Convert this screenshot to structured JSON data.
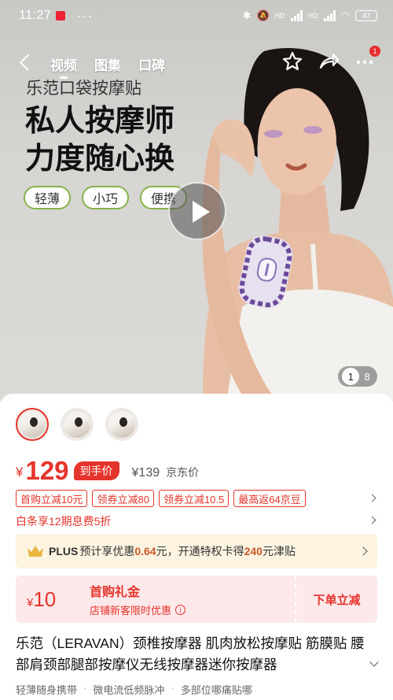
{
  "status_bar": {
    "time": "11:27",
    "dots": "···",
    "hd1": "HD",
    "hd2": "HD",
    "battery": "47"
  },
  "nav": {
    "tabs": [
      "视频",
      "图集",
      "口碑"
    ],
    "active_tab": 0,
    "notification_count": "1"
  },
  "hero": {
    "brand_line": "乐范口袋按摩贴",
    "headline_1": "私人按摩师",
    "headline_2": "力度随心换",
    "pills": [
      "轻薄",
      "小巧",
      "便携"
    ],
    "page_current": "1",
    "page_total": "8"
  },
  "product": {
    "currency": "¥",
    "price": "129",
    "price_tag": "到手价",
    "old_price": "¥139",
    "old_price_label": "京东价",
    "coupons": [
      "首购立减10元",
      "领券立减80",
      "领券立减10.5",
      "最高返64京豆"
    ],
    "installment": "白条享12期息费5折",
    "plus": {
      "label": "PLUS",
      "text_1": "预计享优惠",
      "amount_1": "0.64",
      "text_2": "元，开通特权卡得",
      "amount_2": "240",
      "text_3": "元津贴"
    },
    "gift": {
      "amount_currency": "¥",
      "amount": "10",
      "title": "首购礼金",
      "subtitle": "店铺新客限时优惠",
      "button": "下单立减"
    },
    "title": "乐范（LERAVAN）颈椎按摩器 肌肉放松按摩贴 筋膜贴 腰部肩颈部腿部按摩仪无线按摩器迷你按摩器",
    "features": [
      "轻薄随身携带",
      "微电流低频脉冲",
      "多部位哪痛贴哪"
    ]
  },
  "colors": {
    "accent": "#e5342b",
    "pill_border": "#86b34a",
    "plus_bg": "#fcf4e0",
    "gift_bg": "#fde8ea"
  },
  "icons": [
    "back-arrow-icon",
    "star-icon",
    "share-icon",
    "more-icon",
    "play-icon",
    "crown-icon",
    "info-icon",
    "chevron-right-icon",
    "chevron-down-icon"
  ]
}
